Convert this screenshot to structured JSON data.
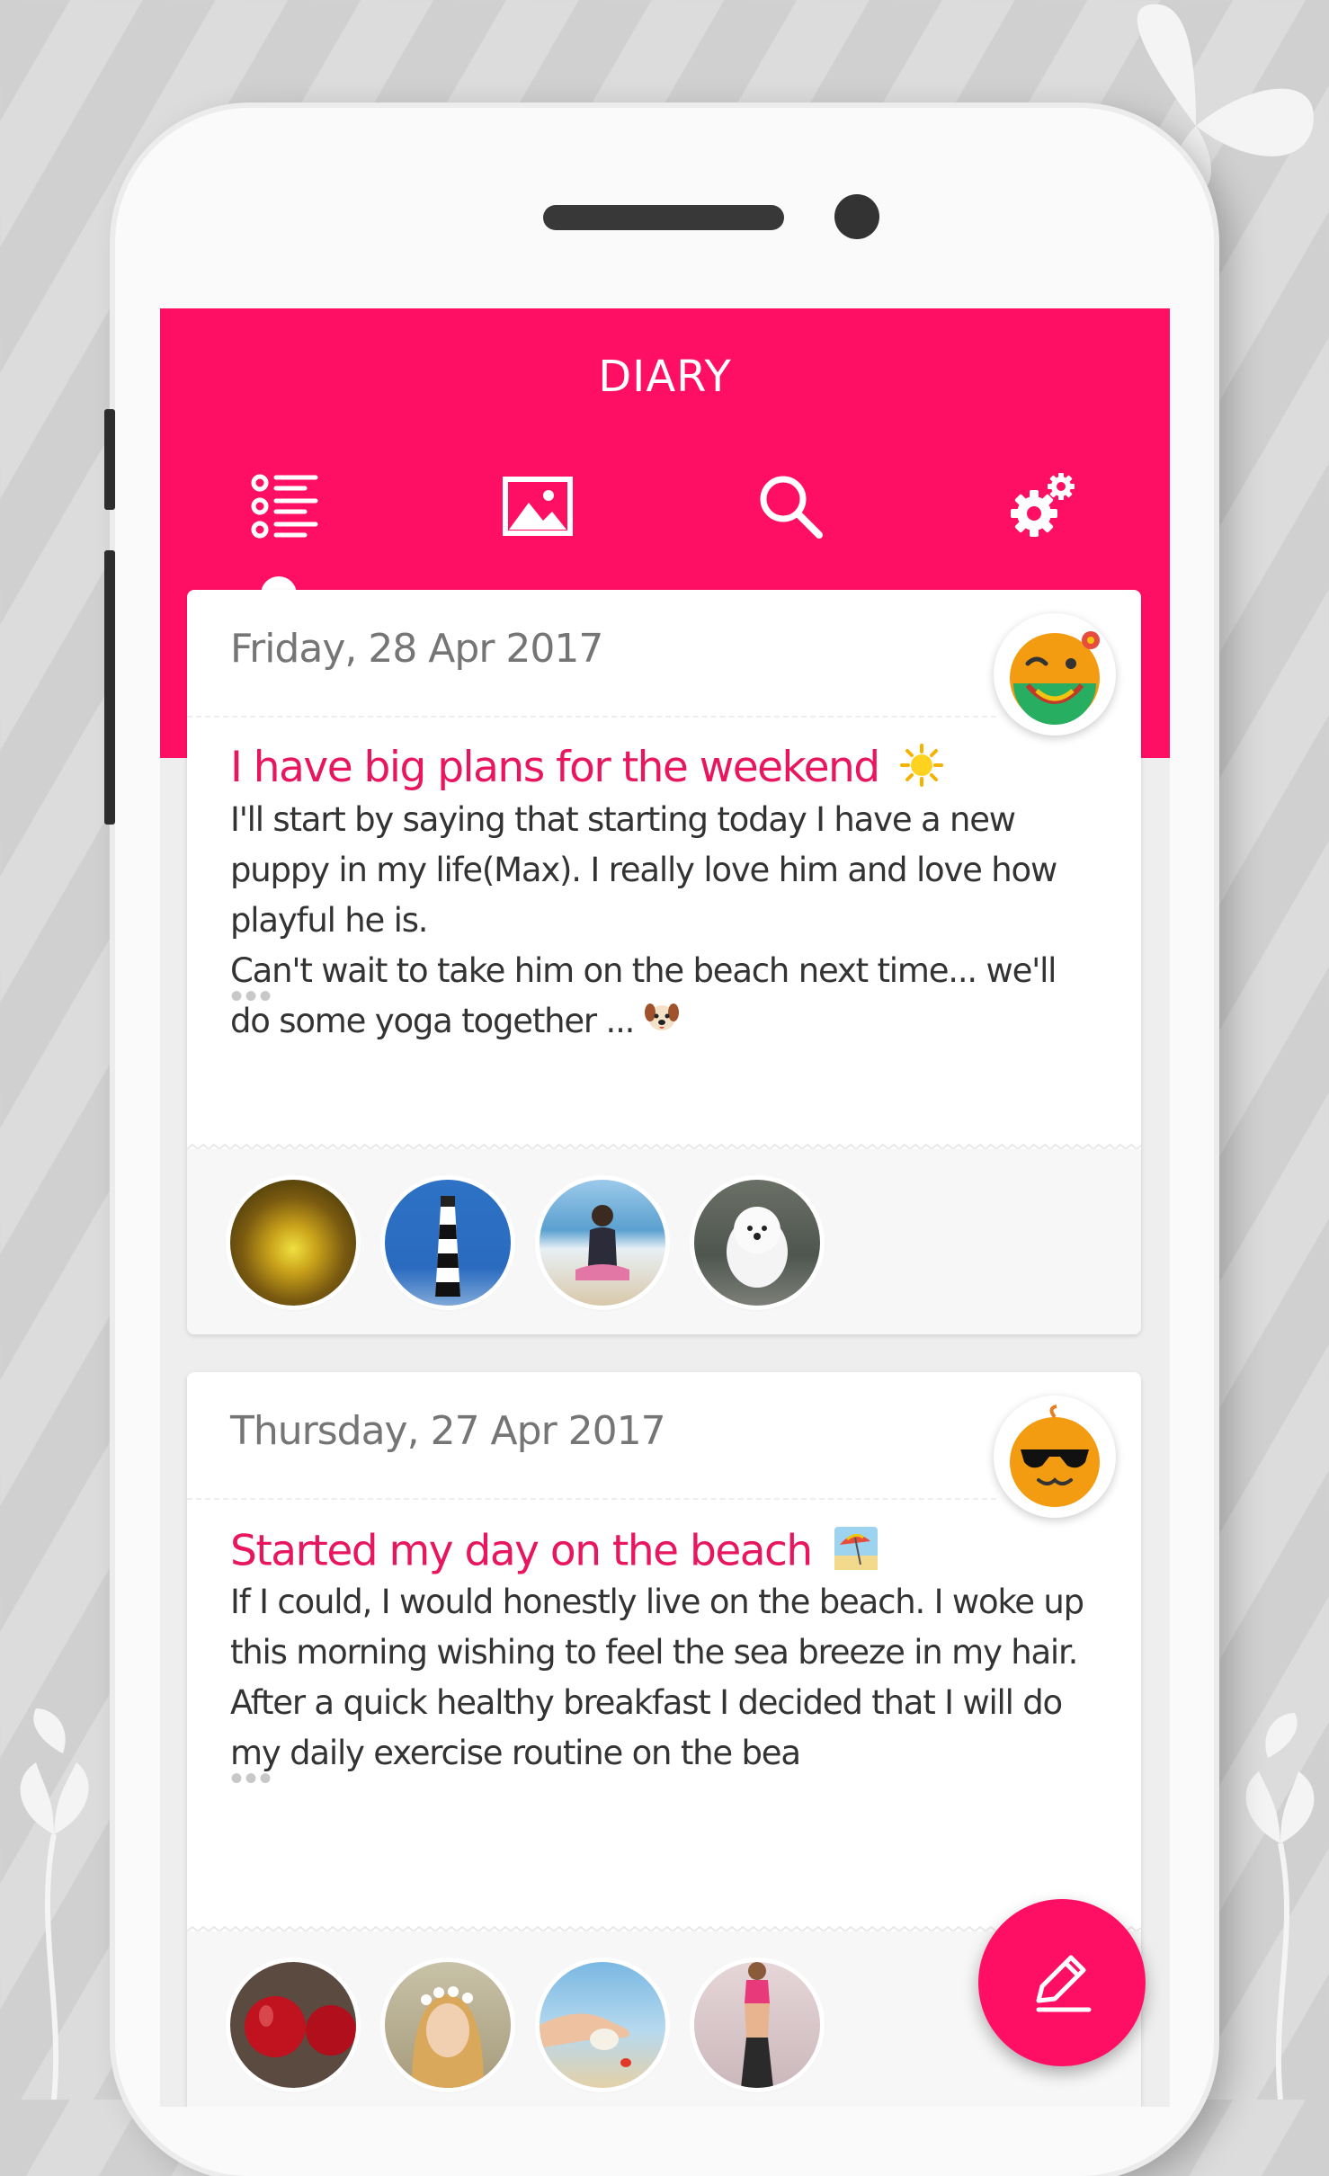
{
  "app": {
    "title": "DIARY",
    "accent_color": "#ff0f64"
  },
  "tabs": [
    {
      "name": "entries",
      "icon": "list-icon",
      "selected": true
    },
    {
      "name": "gallery",
      "icon": "image-icon",
      "selected": false
    },
    {
      "name": "search",
      "icon": "search-icon",
      "selected": false
    },
    {
      "name": "settings",
      "icon": "gear-icon",
      "selected": false
    }
  ],
  "entries": [
    {
      "date": "Friday, 28 Apr 2017",
      "title": "I have big plans for the weekend",
      "title_emoji": "sun-emoji",
      "mood_icon": "happy-mood-icon",
      "body": [
        "I'll start by saying that starting today I have a new puppy in my life(Max). I really love him and love how playful he is.",
        "Can't wait to take him on the beach next time... we'll do some yoga together ..."
      ],
      "body_emoji": "dog-emoji",
      "more": "•••",
      "photos": [
        "forest-path",
        "lighthouse",
        "beach-yoga",
        "white-puppy"
      ]
    },
    {
      "date": "Thursday, 27 Apr 2017",
      "title": "Started my day on the beach",
      "title_emoji": "beach-umbrella-emoji",
      "mood_icon": "cool-sunglasses-mood-icon",
      "body": [
        "If I could, I would honestly live on the beach. I woke up this morning wishing to feel the sea breeze in my hair.",
        "After a quick healthy breakfast I decided that I will do my daily exercise routine on the bea"
      ],
      "more": "•••",
      "photos": [
        "red-apples",
        "flower-crown-girl",
        "hand-with-shell",
        "fitness-woman"
      ]
    }
  ],
  "fab": {
    "icon": "pencil-icon"
  }
}
